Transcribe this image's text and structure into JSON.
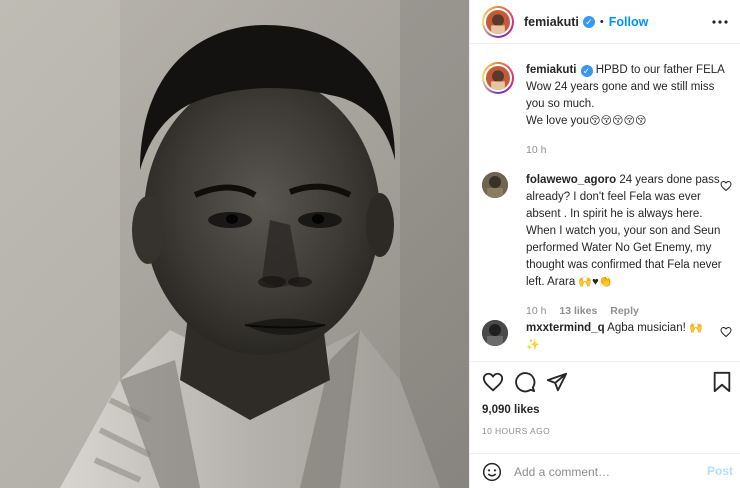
{
  "post": {
    "author": {
      "username": "femiakuti",
      "verified": true,
      "follow_label": "Follow"
    },
    "caption": {
      "username": "femiakuti",
      "text": "HPBD to our father FELA Wow 24 years gone and we still miss you so much.",
      "text2": "We love you",
      "emojis": "😚😚😚😚😚",
      "time": "10 h"
    },
    "comments": [
      {
        "username": "folawewo_agoro",
        "text": "24 years done pass already? I don't feel Fela was ever absent . In spirit he is always here. When I watch you, your son and Seun performed Water No Get Enemy, my thought was confirmed that Fela never left. Arara",
        "emojis": "🙌♥👏",
        "time": "10 h",
        "likes": "13 likes",
        "reply": "Reply"
      },
      {
        "username": "mxxtermind_q",
        "text": "Agba musician!",
        "emojis": "🙌",
        "emoji2": "✨",
        "time": ""
      }
    ],
    "likes_count": "9,090 likes",
    "time_ago": "10 HOURS AGO",
    "add_comment": {
      "placeholder": "Add a comment…",
      "post_label": "Post"
    }
  },
  "colors": {
    "link": "#0095f6",
    "muted": "#8e8e8e",
    "text": "#262626",
    "post_disabled": "#b2dffc"
  },
  "icons": [
    "more-icon",
    "heart-icon",
    "comment-icon",
    "share-icon",
    "save-icon",
    "emoji-icon",
    "verified-icon",
    "heart-small-icon"
  ]
}
